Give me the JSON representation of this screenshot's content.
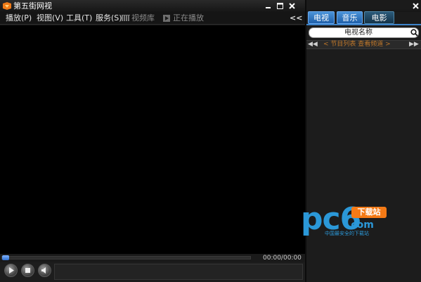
{
  "window": {
    "title": "第五街网视",
    "minimize_icon": "minimize-icon",
    "maximize_icon": "maximize-icon",
    "close_icon": "close-icon"
  },
  "menubar": {
    "items": [
      {
        "label": "播放(P)"
      },
      {
        "label": "视图(V)"
      },
      {
        "label": "工具(T)"
      },
      {
        "label": "服务(S)"
      }
    ],
    "library_label": "视频库",
    "nowplaying_label": "正在播放",
    "collapse_label": "<<"
  },
  "player": {
    "time": "00:00/00:00",
    "progress": 0
  },
  "sidebar": {
    "tabs": [
      {
        "label": "电视",
        "active": false
      },
      {
        "label": "音乐",
        "active": false
      },
      {
        "label": "电影",
        "active": true
      }
    ],
    "search": {
      "value": "电视名称",
      "icon": "search-icon"
    },
    "pager": {
      "prev": "◀◀",
      "next": "▶▶",
      "text": "< 节目列表    查看频道 >"
    }
  },
  "watermark": {
    "text": "pc6",
    "suffix": ".com",
    "badge": "下载站",
    "tagline": "中国最安全的下载站"
  },
  "colors": {
    "accent": "#3d83c9",
    "tab_active": "#153348",
    "pager_text": "#c0782a",
    "watermark": "#2b98d8",
    "badge": "#f47a16"
  }
}
